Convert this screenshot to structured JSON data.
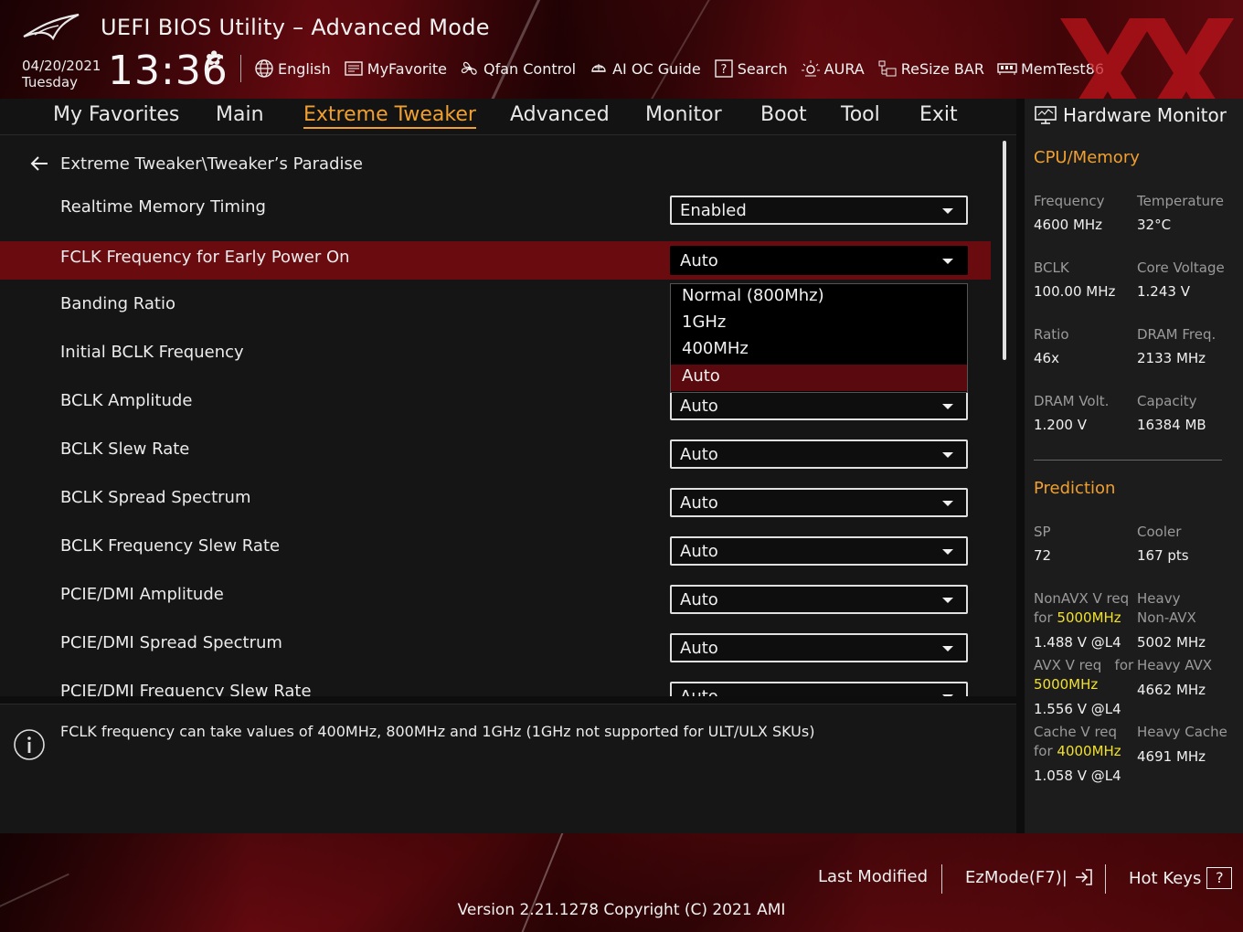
{
  "app": {
    "title": "UEFI BIOS Utility – Advanced Mode",
    "date": "04/20/2021",
    "day": "Tuesday",
    "time": "13:36"
  },
  "toolbar": [
    {
      "label": "English",
      "icon": "globe-icon"
    },
    {
      "label": "MyFavorite",
      "icon": "favorite-icon"
    },
    {
      "label": "Qfan Control",
      "icon": "fan-icon"
    },
    {
      "label": "AI OC Guide",
      "icon": "ai-oc-icon"
    },
    {
      "label": "Search",
      "icon": "search-icon"
    },
    {
      "label": "AURA",
      "icon": "aura-icon"
    },
    {
      "label": "ReSize BAR",
      "icon": "resize-bar-icon"
    },
    {
      "label": "MemTest86",
      "icon": "memtest-icon"
    }
  ],
  "tabs": [
    "My Favorites",
    "Main",
    "Extreme Tweaker",
    "Advanced",
    "Monitor",
    "Boot",
    "Tool",
    "Exit"
  ],
  "active_tab": "Extreme Tweaker",
  "breadcrumb": "Extreme Tweaker\\Tweaker’s Paradise",
  "settings": [
    {
      "label": "Realtime Memory Timing",
      "value": "Enabled"
    },
    {
      "label": "FCLK Frequency for Early Power On",
      "value": "Auto",
      "selected": true
    },
    {
      "label": "Banding Ratio",
      "value": ""
    },
    {
      "label": "Initial BCLK Frequency",
      "value": ""
    },
    {
      "label": "BCLK Amplitude",
      "value": "Auto"
    },
    {
      "label": "BCLK Slew Rate",
      "value": "Auto"
    },
    {
      "label": "BCLK Spread Spectrum",
      "value": "Auto"
    },
    {
      "label": "BCLK Frequency Slew Rate",
      "value": "Auto"
    },
    {
      "label": "PCIE/DMI Amplitude",
      "value": "Auto"
    },
    {
      "label": "PCIE/DMI Spread Spectrum",
      "value": "Auto"
    },
    {
      "label": "PCIE/DMI Frequency Slew Rate",
      "value": "Auto"
    }
  ],
  "dropdown": {
    "options": [
      "Normal (800Mhz)",
      "1GHz",
      "400MHz",
      "Auto"
    ],
    "active": "Auto"
  },
  "help_text": "FCLK frequency can take values of 400MHz, 800MHz  and 1GHz (1GHz not supported for ULT/ULX SKUs)",
  "hw_monitor": {
    "title": "Hardware Monitor",
    "cpu_memory": {
      "heading": "CPU/Memory",
      "frequency_label": "Frequency",
      "frequency": "4600 MHz",
      "temperature_label": "Temperature",
      "temperature": "32°C",
      "bclk_label": "BCLK",
      "bclk": "100.00 MHz",
      "core_voltage_label": "Core Voltage",
      "core_voltage": "1.243 V",
      "ratio_label": "Ratio",
      "ratio": "46x",
      "dram_freq_label": "DRAM Freq.",
      "dram_freq": "2133 MHz",
      "dram_volt_label": "DRAM Volt.",
      "dram_volt": "1.200 V",
      "capacity_label": "Capacity",
      "capacity": "16384 MB"
    },
    "prediction": {
      "heading": "Prediction",
      "sp_label": "SP",
      "sp": "72",
      "cooler_label": "Cooler",
      "cooler": "167 pts",
      "nonavx_label_a": "NonAVX V req",
      "nonavx_label_for": "for",
      "nonavx_freq": "5000MHz",
      "nonavx_value": "1.488 V @L4",
      "heavy_nonavx_label_a": "Heavy",
      "heavy_nonavx_label_b": "Non-AVX",
      "heavy_nonavx": "5002 MHz",
      "avx_label_a": "AVX V req",
      "avx_label_for": "for",
      "avx_freq": "5000MHz",
      "avx_value": "1.556 V @L4",
      "heavy_avx_label": "Heavy AVX",
      "heavy_avx": "4662 MHz",
      "cache_label_a": "Cache V req",
      "cache_label_for": "for",
      "cache_freq": "4000MHz",
      "cache_value": "1.058 V @L4",
      "heavy_cache_label": "Heavy Cache",
      "heavy_cache": "4691 MHz"
    }
  },
  "footer": {
    "last_modified": "Last Modified",
    "ezmode": "EzMode(F7)|",
    "hotkeys": "Hot Keys",
    "hotkeys_key": "?",
    "version": "Version 2.21.1278 Copyright (C) 2021 AMI"
  },
  "colors": {
    "accent": "#f0a030",
    "highlight": "#f0e030",
    "selected_row": "#6a0b10",
    "dropdown_active": "#5a0a0e"
  }
}
